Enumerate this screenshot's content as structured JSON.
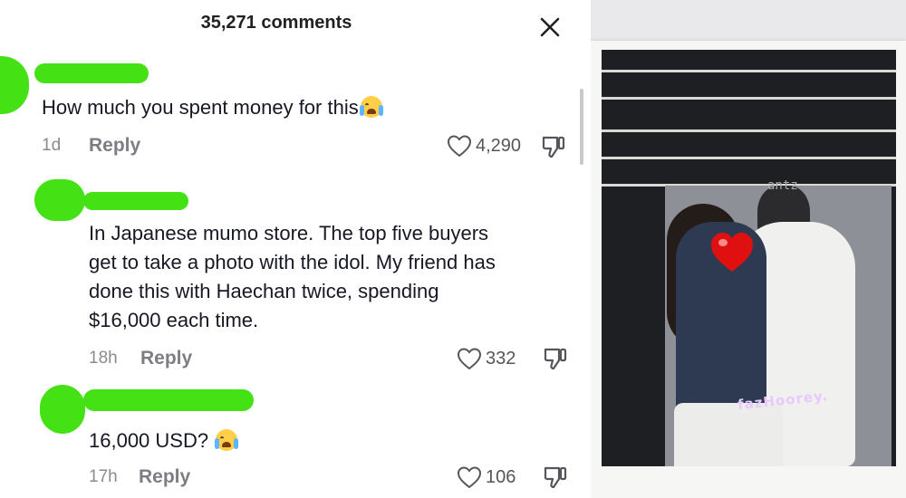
{
  "header": {
    "title": "35,271 comments"
  },
  "comments": [
    {
      "text": "How much you spent money for this",
      "emoji": "loudly-crying-face",
      "time": "1d",
      "reply_label": "Reply",
      "likes": "4,290"
    },
    {
      "text_lines": [
        "In Japanese mumo store. The top five buyers",
        "get to take a photo with the idol. My friend has",
        "done this with Haechan twice, spending",
        "$16,000 each time."
      ],
      "time": "18h",
      "reply_label": "Reply",
      "likes": "332"
    },
    {
      "text": "16,000 USD?",
      "emoji": "loudly-crying-face",
      "time": "17h",
      "reply_label": "Reply",
      "likes": "106"
    }
  ],
  "photo": {
    "watermark": "antz",
    "signature": "fazHoorey.",
    "sticker": "red-heart"
  },
  "colors": {
    "redaction_green": "#44e214",
    "text": "#161823",
    "muted": "#8a8b91",
    "heart": "#e01010"
  }
}
